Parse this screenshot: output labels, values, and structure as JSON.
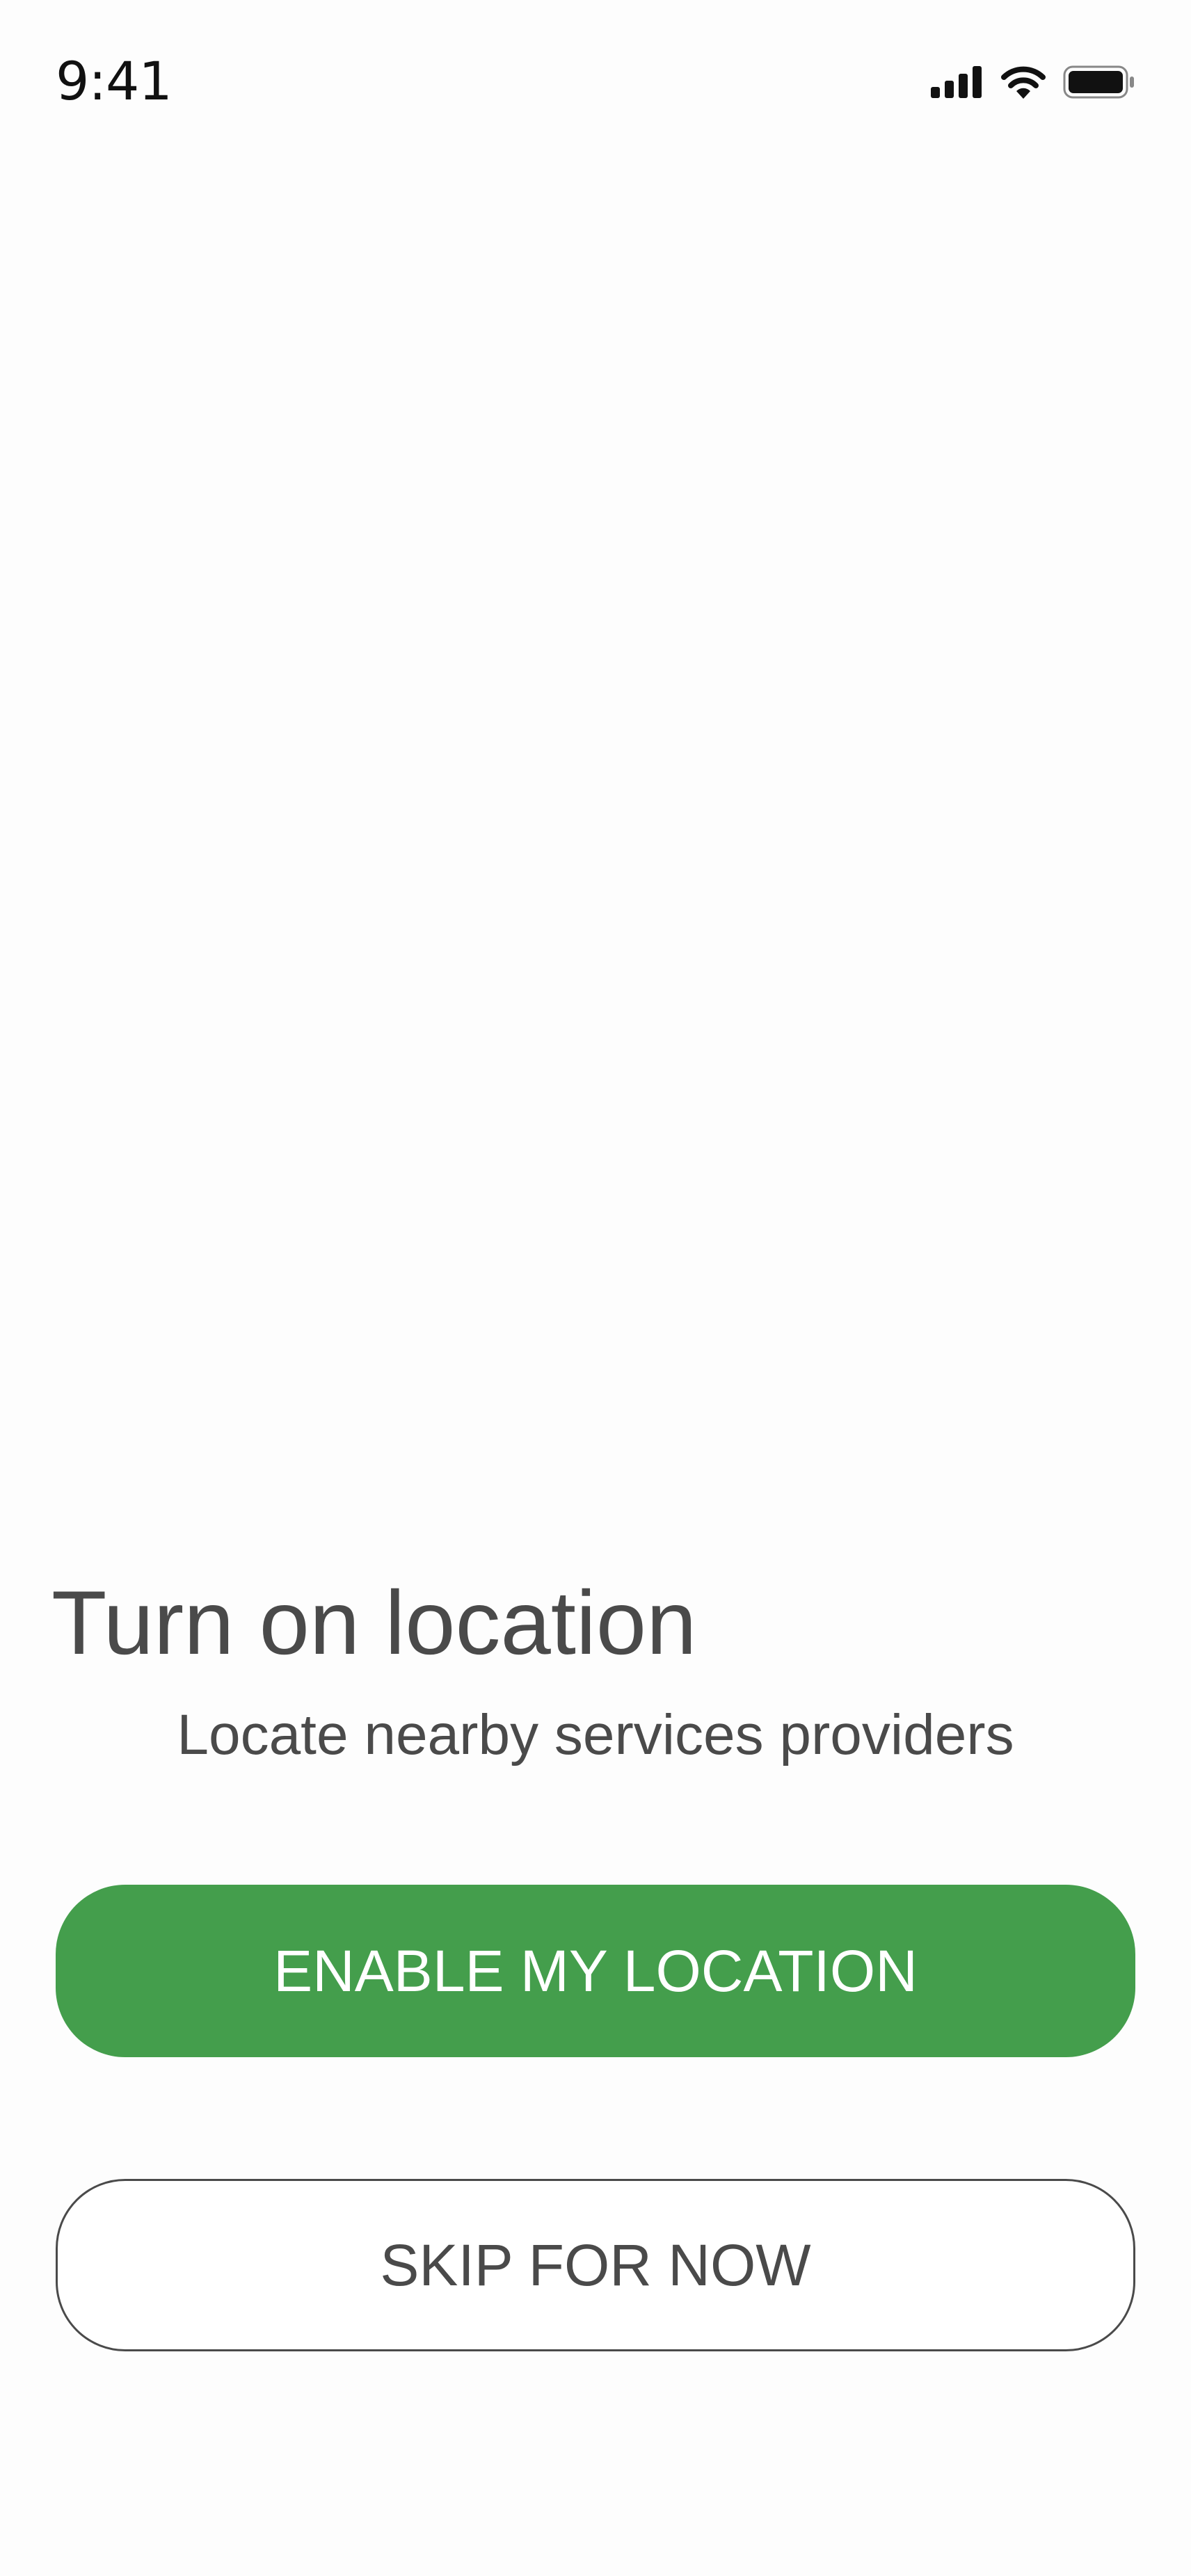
{
  "status_bar": {
    "time": "9:41",
    "icons": [
      "signal-icon",
      "wifi-icon",
      "battery-icon"
    ]
  },
  "main": {
    "title": "Turn on location",
    "subtitle": "Locate nearby services providers"
  },
  "actions": {
    "enable_label": "ENABLE MY LOCATION",
    "skip_label": "SKIP FOR NOW"
  },
  "colors": {
    "accent": "#449e4c",
    "text": "#4a4a4a",
    "background": "#fdfdfd"
  }
}
